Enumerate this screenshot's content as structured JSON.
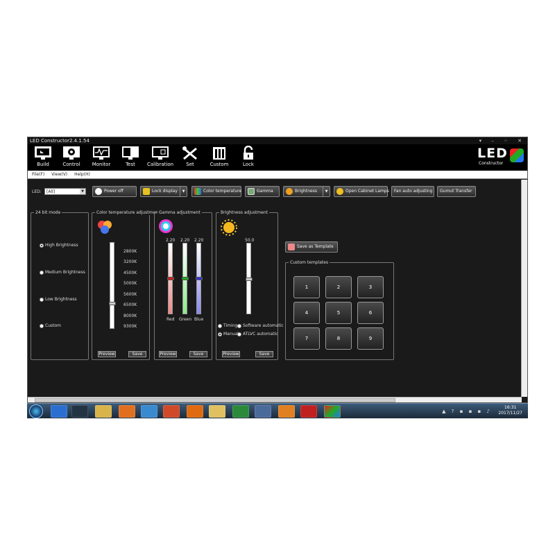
{
  "window": {
    "title": "LED Constructor2.4.1.54"
  },
  "toolbar": {
    "items": [
      {
        "label": "Build",
        "icon": "build-icon"
      },
      {
        "label": "Control",
        "icon": "control-icon"
      },
      {
        "label": "Monitor",
        "icon": "monitor-icon"
      },
      {
        "label": "Test",
        "icon": "test-icon"
      },
      {
        "label": "Calibration",
        "icon": "calibration-icon"
      },
      {
        "label": "Set",
        "icon": "set-icon"
      },
      {
        "label": "Custom",
        "icon": "custom-icon"
      },
      {
        "label": "Lock",
        "icon": "lock-icon"
      }
    ]
  },
  "logo": {
    "main": "LED",
    "sub": "Constructor"
  },
  "menu": [
    "File(F)",
    "View(V)",
    "Help(H)"
  ],
  "led": {
    "label": "LED:",
    "value": "[All]"
  },
  "actions": {
    "power_off": "Power off",
    "lock_display": "Lock display",
    "color_temperature": "Color temperature",
    "gamma": "Gamma",
    "brightness": "Brightness",
    "open_cabinet_lamps": "Open Cabinet Lamps",
    "fan_auto": "Fan auto adjusting",
    "gumut_transfer": "Gumut Transfer"
  },
  "mode24": {
    "title": "24 bit mode",
    "options": [
      "High Brightness",
      "Medium Brightness",
      "Low Brightness",
      "Custom"
    ],
    "selected": "High Brightness"
  },
  "colortemp": {
    "title": "Color temperature adjustment",
    "ticks": [
      "2800K",
      "3200K",
      "4500K",
      "5000K",
      "5600K",
      "6500K",
      "8000K",
      "9300K"
    ],
    "level": 0.71,
    "preview": "Preview",
    "save": "Save"
  },
  "gamma": {
    "title": "Gamma adjustment",
    "channels": [
      {
        "name": "Red",
        "value": "2.20",
        "color": "#e03030"
      },
      {
        "name": "Green",
        "value": "2.20",
        "color": "#20b040"
      },
      {
        "name": "Blue",
        "value": "2.20",
        "color": "#3050e0"
      }
    ],
    "preview": "Preview",
    "save": "Save"
  },
  "brightness": {
    "title": "Brightness adjustment",
    "value": "50.0",
    "level": 0.5,
    "options": [
      "Timing",
      "Software automatic",
      "Manual",
      "ATLVC automatic"
    ],
    "selected": "Manual",
    "preview": "Preview",
    "save": "Save"
  },
  "templates": {
    "save_label": "Save as Template",
    "title": "Custom templates",
    "items": [
      "1",
      "2",
      "3",
      "4",
      "5",
      "6",
      "7",
      "8",
      "9"
    ]
  },
  "taskbar": {
    "time": "16:31",
    "date": "2017/11/27"
  }
}
